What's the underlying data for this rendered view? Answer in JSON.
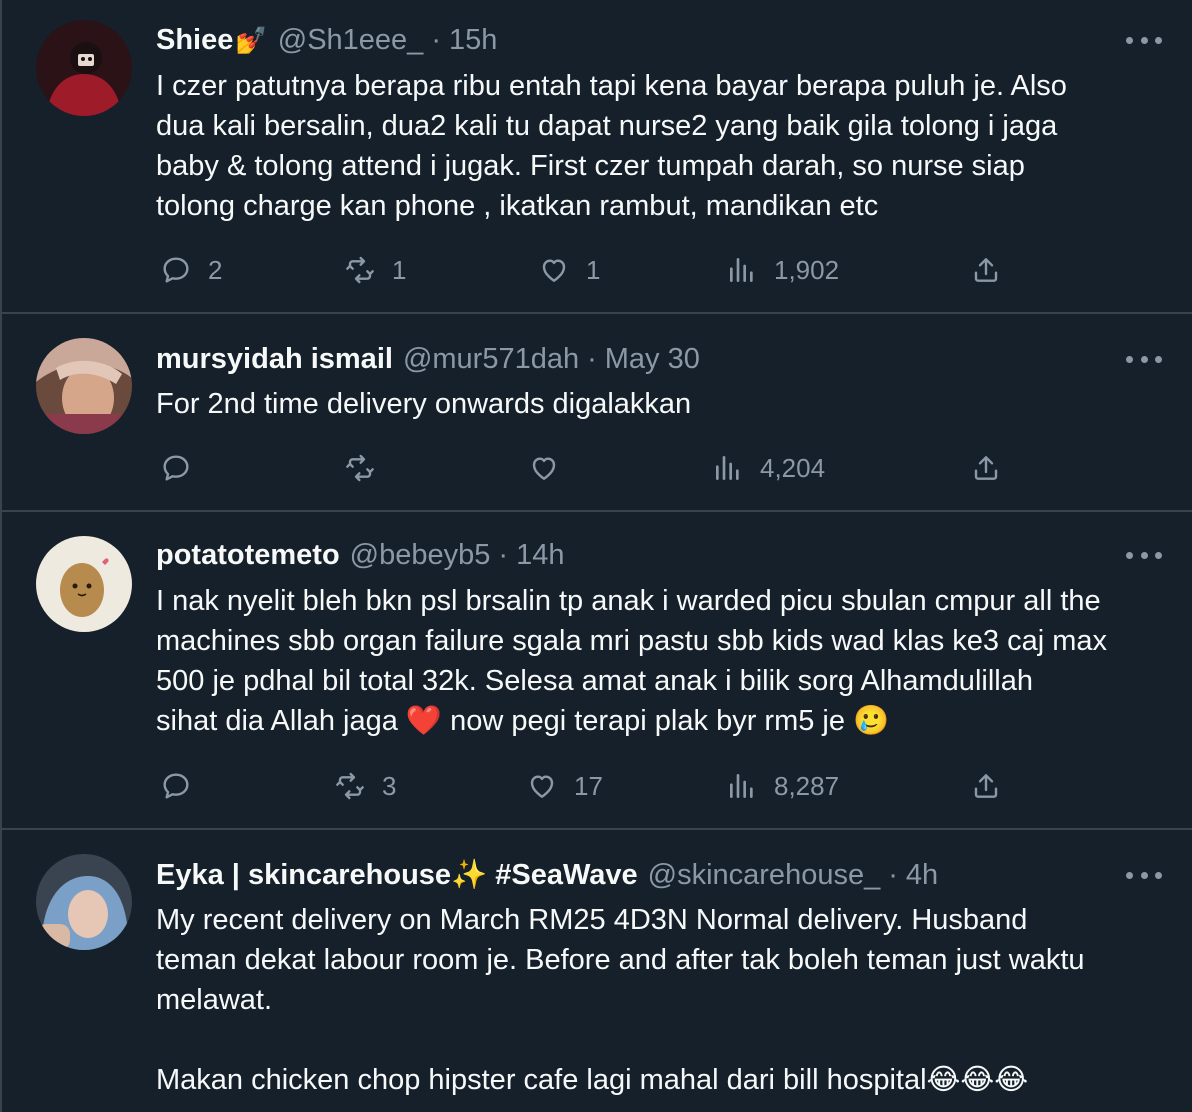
{
  "tweets": [
    {
      "name": "Shiee",
      "name_emoji": "💅",
      "handle": "@Sh1eee_",
      "time": "15h",
      "lines": [
        "I czer patutnya berapa ribu entah tapi kena bayar berapa puluh je. Also",
        "dua kali bersalin, dua2 kali tu dapat nurse2 yang baik gila tolong i jaga",
        "baby & tolong attend i jugak. First czer tumpah darah, so nurse siap",
        "tolong charge kan phone , ikatkan rambut, mandikan etc"
      ],
      "replies": "2",
      "retweets": "1",
      "likes": "1",
      "views": "1,902"
    },
    {
      "name": "mursyidah ismail",
      "name_emoji": "",
      "handle": "@mur571dah",
      "time": "May 30",
      "lines": [
        "For 2nd time delivery onwards digalakkan"
      ],
      "replies": "",
      "retweets": "",
      "likes": "",
      "views": "4,204"
    },
    {
      "name": "potatotemeto",
      "name_emoji": "",
      "handle": "@bebeyb5",
      "time": "14h",
      "lines": [
        "I nak nyelit bleh bkn psl brsalin tp anak i warded picu sbulan cmpur all the",
        "machines sbb organ failure sgala mri pastu sbb kids wad klas ke3 caj max",
        "500 je pdhal bil total 32k. Selesa amat anak i bilik sorg Alhamdulillah",
        "sihat dia Allah jaga ❤️ now pegi terapi plak byr rm5 je 🥲"
      ],
      "replies": "",
      "retweets": "3",
      "likes": "17",
      "views": "8,287"
    },
    {
      "name": "Eyka | skincarehouse✨ #SeaWave",
      "name_emoji": "",
      "handle": "@skincarehouse_",
      "time": "4h",
      "lines": [
        "My recent delivery on March RM25 4D3N Normal delivery. Husband",
        "teman dekat labour room je. Before and after tak boleh teman just waktu",
        "melawat.",
        "",
        "Makan chicken chop hipster cafe lagi mahal dari bill hospital😂😂😂"
      ],
      "replies": "",
      "retweets": "",
      "likes": "",
      "views": ""
    }
  ],
  "icons": {
    "reply": "reply-icon",
    "retweet": "retweet-icon",
    "like": "like-icon",
    "views": "views-icon",
    "share": "share-icon",
    "more": "more-icon"
  },
  "colors": {
    "background": "#15202b",
    "divider": "#38444d",
    "text": "#f7f9f9",
    "secondary": "#8b98a5"
  }
}
